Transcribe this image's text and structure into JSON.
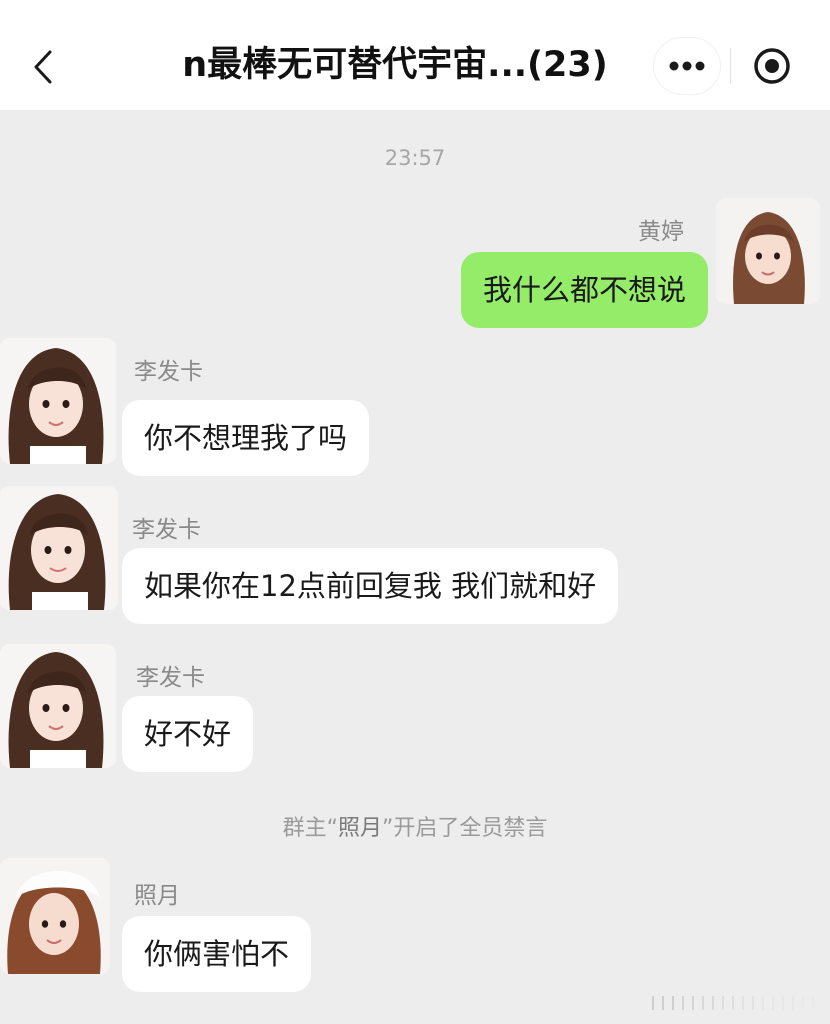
{
  "header": {
    "title": "n最棒无可替代宇宙...(23)",
    "back_icon": "chevron-left-icon",
    "more_icon": "more-dots-icon",
    "target_icon": "target-icon"
  },
  "chat": {
    "timestamp": "23:57",
    "messages": [
      {
        "sender": "黄婷",
        "text": "我什么都不想说",
        "direction": "outgoing"
      },
      {
        "sender": "李发卡",
        "text": "你不想理我了吗",
        "direction": "incoming"
      },
      {
        "sender": "李发卡",
        "text": "如果你在12点前回复我 我们就和好",
        "direction": "incoming"
      },
      {
        "sender": "李发卡",
        "text": "好不好",
        "direction": "incoming"
      },
      {
        "sender": "照月",
        "text": "你俩害怕不",
        "direction": "incoming"
      }
    ],
    "system_notice": {
      "prefix": "群主“",
      "name": "照月",
      "suffix": "”开启了全员禁言"
    }
  },
  "colors": {
    "outgoing_bubble": "#95ec69",
    "incoming_bubble": "#ffffff",
    "background": "#ededed"
  }
}
